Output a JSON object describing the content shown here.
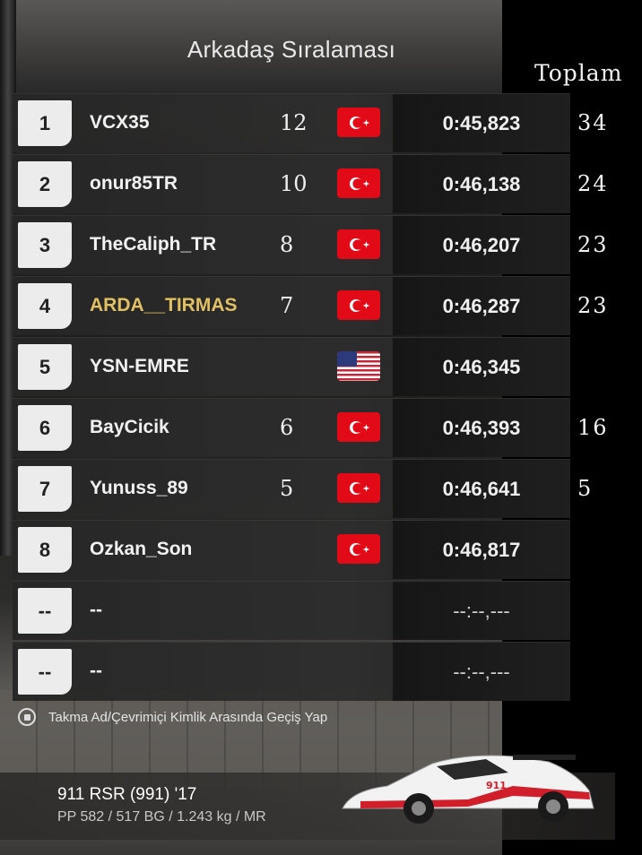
{
  "header": {
    "title": "Arkadaş Sıralaması",
    "annotation_total_label": "Toplam"
  },
  "leaderboard": {
    "rows": [
      {
        "rank": "1",
        "name": "VCX35",
        "points": "12",
        "flag": "turkey-flag-icon",
        "time": "0:45,823",
        "total": "34",
        "highlight": false
      },
      {
        "rank": "2",
        "name": "onur85TR",
        "points": "10",
        "flag": "turkey-flag-icon",
        "time": "0:46,138",
        "total": "24",
        "highlight": false
      },
      {
        "rank": "3",
        "name": "TheCaliph_TR",
        "points": "8",
        "flag": "turkey-flag-icon",
        "time": "0:46,207",
        "total": "23",
        "highlight": false
      },
      {
        "rank": "4",
        "name": "ARDA__TIRMAS",
        "points": "7",
        "flag": "turkey-flag-icon",
        "time": "0:46,287",
        "total": "23",
        "highlight": true
      },
      {
        "rank": "5",
        "name": "YSN-EMRE",
        "points": "",
        "flag": "usa-flag-icon",
        "time": "0:46,345",
        "total": "",
        "highlight": false
      },
      {
        "rank": "6",
        "name": "BayCicik",
        "points": "6",
        "flag": "turkey-flag-icon",
        "time": "0:46,393",
        "total": "16",
        "highlight": false
      },
      {
        "rank": "7",
        "name": "Yunuss_89",
        "points": "5",
        "flag": "turkey-flag-icon",
        "time": "0:46,641",
        "total": "5",
        "highlight": false
      },
      {
        "rank": "8",
        "name": "Ozkan_Son",
        "points": "",
        "flag": "turkey-flag-icon",
        "time": "0:46,817",
        "total": "",
        "highlight": false
      },
      {
        "rank": "--",
        "name": "--",
        "points": "",
        "flag": "",
        "time": "--:--,---",
        "total": "",
        "highlight": false
      },
      {
        "rank": "--",
        "name": "--",
        "points": "",
        "flag": "",
        "time": "--:--,---",
        "total": "",
        "highlight": false
      }
    ]
  },
  "hint": {
    "icon": "square-button-icon",
    "label": "Takma Ad/Çevrimiçi Kimlik Arasında Geçiş Yap"
  },
  "car": {
    "name": "911 RSR (991) '17",
    "specs": "PP 582 / 517 BG / 1.243 kg / MR",
    "livery_number": "911"
  },
  "colors": {
    "highlight_name": "#e0c063",
    "turkey_red": "#e30a17",
    "rank_box": "#ececec"
  }
}
